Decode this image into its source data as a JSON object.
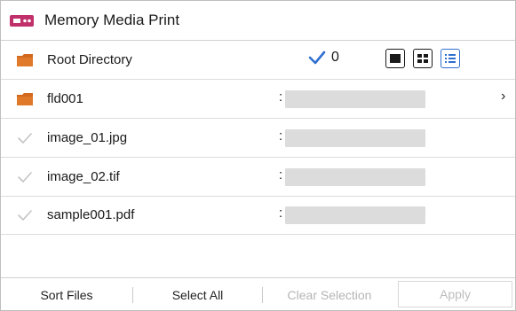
{
  "header": {
    "title": "Memory Media Print",
    "icon": "usb-drive-icon",
    "icon_color": "#c0306a"
  },
  "root": {
    "label": "Root Directory",
    "selected_count": "0",
    "check_color": "#2f6fd0",
    "views": [
      {
        "icon": "single-view-icon",
        "active": false
      },
      {
        "icon": "grid-view-icon",
        "active": false
      },
      {
        "icon": "list-view-icon",
        "active": true
      }
    ]
  },
  "items": [
    {
      "type": "folder",
      "name": "fld001",
      "separator": ":",
      "has_chevron": true
    },
    {
      "type": "file",
      "name": "image_01.jpg",
      "separator": ":"
    },
    {
      "type": "file",
      "name": "image_02.tif",
      "separator": ":"
    },
    {
      "type": "file",
      "name": "sample001.pdf",
      "separator": ":"
    }
  ],
  "folder_color": "#d2691e",
  "bottom_bar": {
    "sort_label": "Sort Files",
    "select_all_label": "Select All",
    "clear_label": "Clear Selection",
    "apply_label": "Apply"
  }
}
